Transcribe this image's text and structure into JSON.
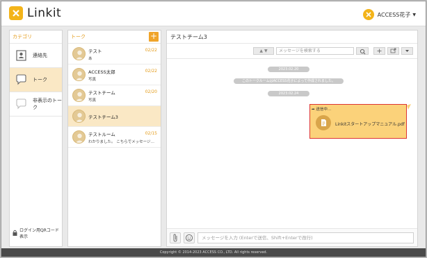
{
  "app": {
    "name": "Linkit",
    "brand_color": "#f3b41a"
  },
  "user": {
    "name": "ACCESS花子"
  },
  "category": {
    "header": "カテゴリ",
    "items": [
      {
        "label": "連絡先",
        "icon": "contacts-icon"
      },
      {
        "label": "トーク",
        "icon": "chat-bubble-icon"
      },
      {
        "label": "非表示のトーク",
        "icon": "hidden-chat-icon"
      }
    ],
    "login_qr": "ログイン用QRコード表示"
  },
  "talks": {
    "header": "トーク",
    "add": "+",
    "items": [
      {
        "name": "テスト",
        "date": "02/22",
        "preview": "あ"
      },
      {
        "name": "ACCESS太郎",
        "date": "02/22",
        "preview": "写真"
      },
      {
        "name": "テストチーム",
        "date": "02/20",
        "preview": "写真"
      },
      {
        "name": "テストチーム3",
        "date": "",
        "preview": ""
      },
      {
        "name": "テストルーム",
        "date": "02/15",
        "preview": "わかりました。 こちらでメッセージ…"
      }
    ]
  },
  "chat": {
    "title": "テストチーム3",
    "search_placeholder": "メッセージを検索する",
    "date1": "2023.02.20",
    "system_msg": "このトークルームはACCESS花子によって作成されました。",
    "date2": "2023.02.24",
    "sending_label": "送信中...",
    "file_name": "Linkitスタートアップマニュアル.pdf",
    "input_placeholder": "メッセージを入力 (Enterで送信、Shift+Enterで改行)"
  },
  "footer": {
    "copyright": "Copyright © 2014-2023 ACCESS CO., LTD. All rights reserved."
  }
}
